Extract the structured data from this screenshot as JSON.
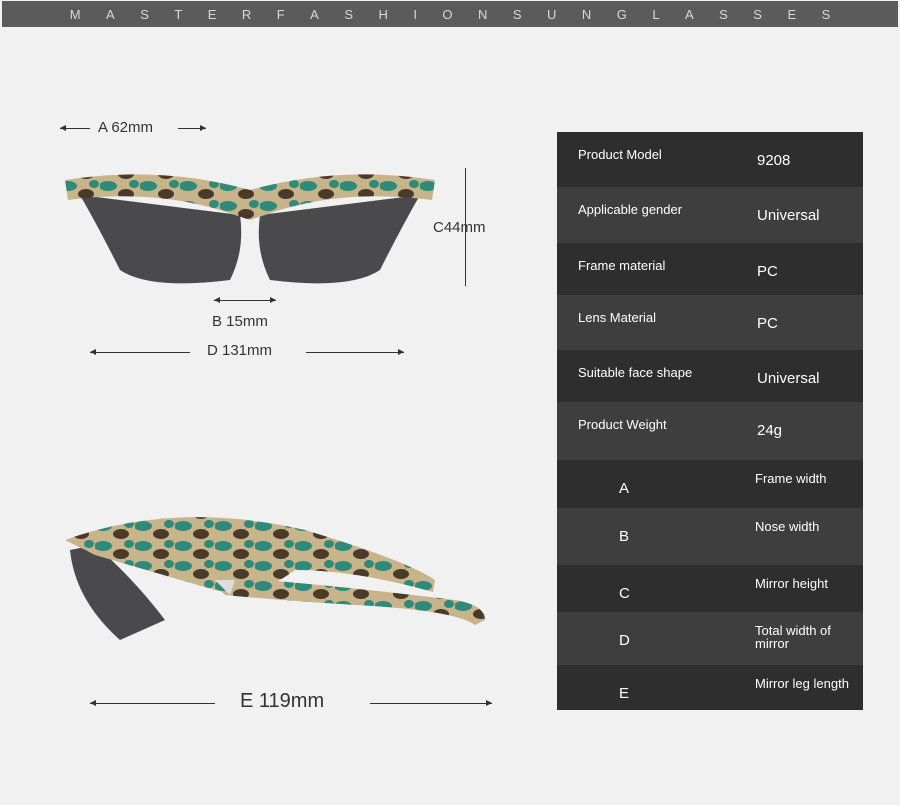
{
  "banner": {
    "letters": [
      "M",
      "A",
      "S",
      "T",
      "E",
      "R",
      "F",
      "A",
      "S",
      "H",
      "I",
      "O",
      "N",
      "S",
      "U",
      "N",
      "G",
      "L",
      "A",
      "S",
      "S",
      "E",
      "S"
    ]
  },
  "dimensions": {
    "a": "A 62mm",
    "b": "B 15mm",
    "c": "C44mm",
    "d": "D 131mm",
    "e": "E 119mm"
  },
  "specs": [
    {
      "key": "Product Model",
      "value": "9208"
    },
    {
      "key": "Applicable gender",
      "value": "Universal"
    },
    {
      "key": "Frame material",
      "value": "PC"
    },
    {
      "key": "Lens Material",
      "value": "PC"
    },
    {
      "key": "Suitable face shape",
      "value": "Universal"
    },
    {
      "key": "Product Weight",
      "value": "24g"
    }
  ],
  "legend": [
    {
      "key": "A",
      "value": "Frame width"
    },
    {
      "key": "B",
      "value": "Nose width"
    },
    {
      "key": "C",
      "value": "Mirror height"
    },
    {
      "key": "D",
      "value": "Total width of mirror"
    },
    {
      "key": "E",
      "value": "Mirror leg length"
    }
  ],
  "colors": {
    "dark_row": "#2e2e2e",
    "light_row": "#3e3e3e",
    "camo_green": "#2f8a7a",
    "camo_tan": "#c8b48a",
    "camo_brown": "#4a3a2a",
    "lens": "#4a4a4c"
  }
}
